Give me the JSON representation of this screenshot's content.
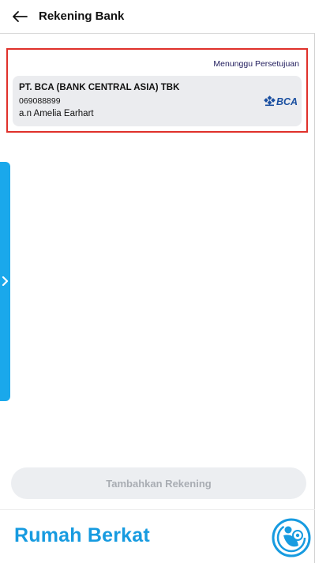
{
  "header": {
    "back_icon": "arrow-left-icon",
    "title": "Rekening Bank"
  },
  "account": {
    "status": "Menunggu Persetujuan",
    "bank_name": "PT. BCA (BANK CENTRAL ASIA) TBK",
    "account_number": "069088899",
    "holder": "a.n Amelia Earhart",
    "bank_logo_text": "BCA",
    "highlight_color": "#e0312b"
  },
  "side_tab": {
    "icon": "chevron-right-icon",
    "color": "#1aa8eb"
  },
  "add_button": {
    "label": "Tambahkan Rekening"
  },
  "footer": {
    "brand": "Rumah Berkat",
    "brand_color": "#179be0",
    "logo_icon": "rumah-berkat-logo-icon"
  }
}
